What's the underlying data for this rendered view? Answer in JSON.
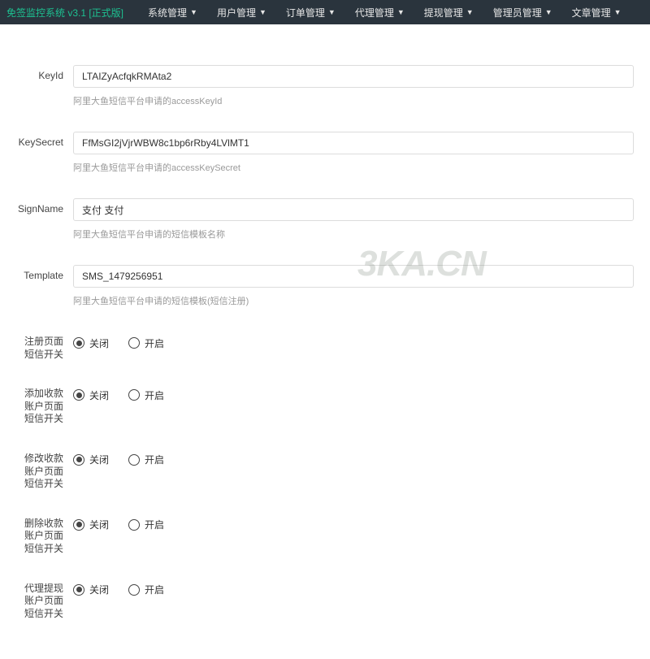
{
  "header": {
    "brand": "免签监控系统 v3.1 [正式版]",
    "nav": [
      {
        "label": "系统管理"
      },
      {
        "label": "用户管理"
      },
      {
        "label": "订单管理"
      },
      {
        "label": "代理管理"
      },
      {
        "label": "提现管理"
      },
      {
        "label": "管理员管理"
      },
      {
        "label": "文章管理"
      }
    ]
  },
  "form": {
    "keyid": {
      "label": "KeyId",
      "value": "LTAIZyAcfqkRMAta2",
      "help": "阿里大鱼短信平台申请的accessKeyId"
    },
    "keysecret": {
      "label": "KeySecret",
      "value": "FfMsGI2jVjrWBW8c1bp6rRby4LVlMT1",
      "help": "阿里大鱼短信平台申请的accessKeySecret"
    },
    "signname": {
      "label": "SignName",
      "value": "支付 支付",
      "help": "阿里大鱼短信平台申请的短信模板名称"
    },
    "template": {
      "label": "Template",
      "value": "SMS_1479256951",
      "help": "阿里大鱼短信平台申请的短信模板(短信注册)"
    },
    "radios": [
      {
        "label": "注册页面短信开关",
        "off": "关闭",
        "on": "开启",
        "value": "off"
      },
      {
        "label": "添加收款账户页面短信开关",
        "off": "关闭",
        "on": "开启",
        "value": "off"
      },
      {
        "label": "修改收款账户页面短信开关",
        "off": "关闭",
        "on": "开启",
        "value": "off"
      },
      {
        "label": "删除收款账户页面短信开关",
        "off": "关闭",
        "on": "开启",
        "value": "off"
      },
      {
        "label": "代理提现账户页面短信开关",
        "off": "关闭",
        "on": "开启",
        "value": "off"
      }
    ]
  },
  "watermark": "3KA.CN"
}
